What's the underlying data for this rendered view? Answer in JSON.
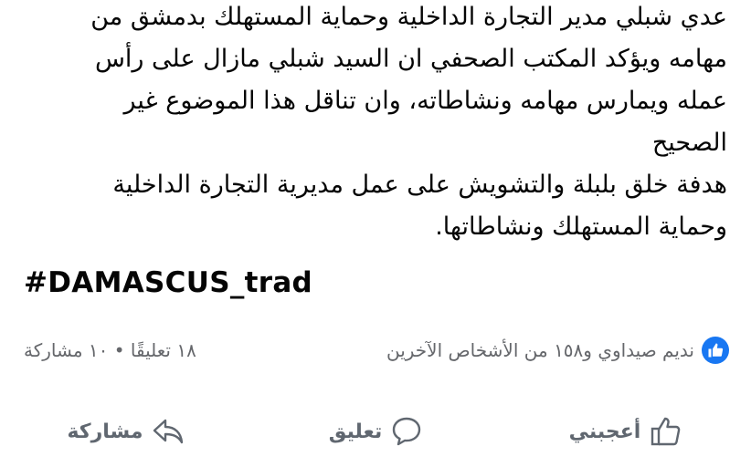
{
  "post": {
    "lines": [
      "عدي شبلي مدير التجارة الداخلية وحماية المستهلك بدمشق من",
      "مهامه ويؤكد المكتب الصحفي ان السيد شبلي مازال على رأس",
      "عمله ويمارس مهامه ونشاطاته، وان تناقل هذا الموضوع  غير",
      "الصحيح",
      "هدفة خلق بلبلة  والتشويش على عمل مديرية التجارة الداخلية",
      "وحماية المستهلك ونشاطاتها."
    ],
    "hashtag": "#DAMASCUS_trad"
  },
  "reactions": {
    "summary": "نديم صيداوي و١٥٨ من الأشخاص الآخرين",
    "counts": "١٨ تعليقًا • ١٠ مشاركة",
    "icon": "like-icon",
    "color": "#1877f2"
  },
  "actions": {
    "like_label": "أعجبني",
    "comment_label": "تعليق",
    "share_label": "مشاركة"
  }
}
